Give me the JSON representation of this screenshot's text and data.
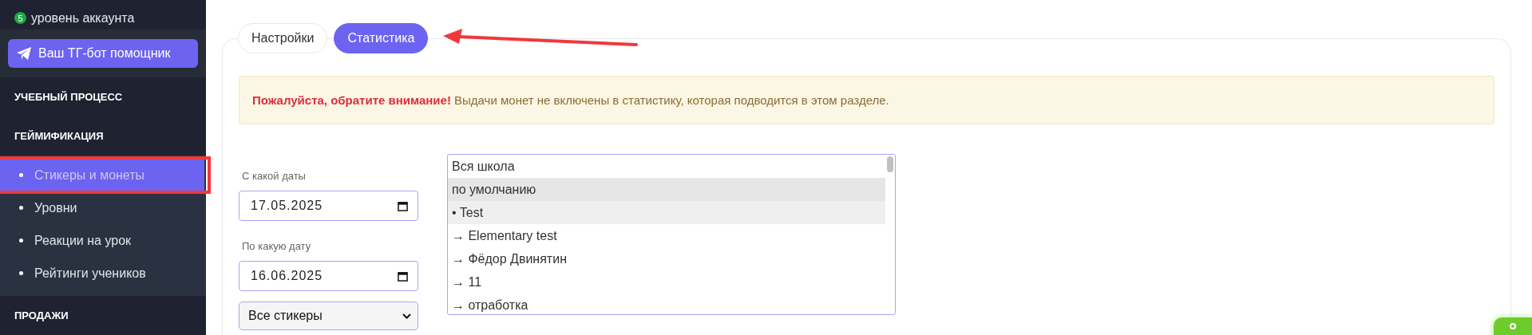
{
  "sidebar": {
    "account_level": {
      "badge": "5",
      "label": "уровень аккаунта"
    },
    "bot_button": {
      "label": "Ваш ТГ-бот помощник"
    },
    "sections": [
      {
        "title": "УЧЕБНЫЙ ПРОЦЕСС"
      },
      {
        "title": "ГЕЙМИФИКАЦИЯ",
        "items": [
          {
            "label": "Стикеры и монеты",
            "selected": true
          },
          {
            "label": "Уровни",
            "selected": false
          },
          {
            "label": "Реакции на урок",
            "selected": false
          },
          {
            "label": "Рейтинги учеников",
            "selected": false
          }
        ]
      },
      {
        "title": "ПРОДАЖИ"
      }
    ]
  },
  "tabs": [
    {
      "label": "Настройки",
      "selected": false
    },
    {
      "label": "Статистика",
      "selected": true
    }
  ],
  "alert": {
    "text": "**Пожалуйста, обратите внимание!** Выдачи монет не включены в статистику, которая подводится в этом разделе."
  },
  "filters": {
    "date_from": {
      "label": "С какой даты",
      "value": "17.05.2025"
    },
    "date_to": {
      "label": "По какую дату",
      "value": "16.06.2025"
    },
    "sticker_select": {
      "value": "Все стикеры"
    }
  },
  "group_list": [
    {
      "label": "Вся школа",
      "kind": "plain"
    },
    {
      "label": "по умолчанию",
      "kind": "header"
    },
    {
      "label": "• Test",
      "kind": "subheader"
    },
    {
      "label": "→ Elementary test",
      "kind": "plain"
    },
    {
      "label": "→ Фёдор Двинятин",
      "kind": "plain"
    },
    {
      "label": "→ 11",
      "kind": "plain"
    },
    {
      "label": "→ отработка",
      "kind": "plain"
    }
  ]
}
